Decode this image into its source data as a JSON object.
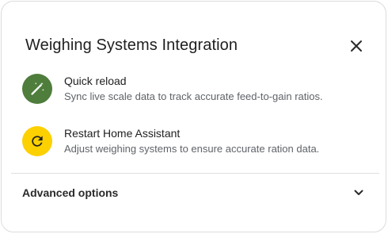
{
  "dialog": {
    "title": "Weighing Systems Integration",
    "close_icon": "close-icon"
  },
  "items": [
    {
      "title": "Quick reload",
      "description": "Sync live scale data to track accurate feed-to-gain ratios.",
      "icon": "magic-wand-icon",
      "icon_bg": "#4e7d3c",
      "icon_fg": "#ffffff"
    },
    {
      "title": "Restart Home Assistant",
      "description": "Adjust weighing systems to ensure accurate ration data.",
      "icon": "refresh-icon",
      "icon_bg": "#fdd000",
      "icon_fg": "#1f1f1f"
    }
  ],
  "advanced": {
    "label": "Advanced options",
    "icon": "chevron-down-icon"
  }
}
